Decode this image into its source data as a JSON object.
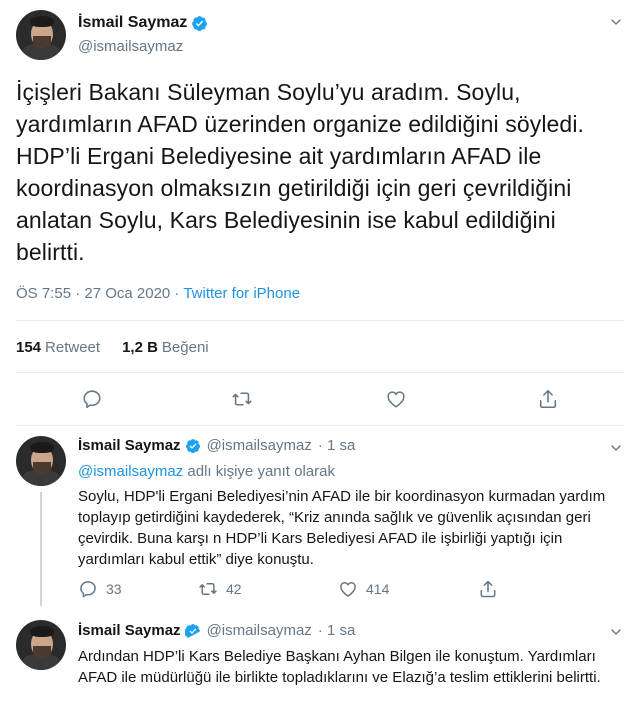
{
  "main_tweet": {
    "author_name": "İsmail Saymaz",
    "handle": "@ismailsaymaz",
    "text": "İçişleri Bakanı Süleyman Soylu’yu aradım. Soylu, yardımların AFAD üzerinden organize edildiğini söyledi. HDP’li Ergani Belediyesine ait yardımların AFAD ile koordinasyon olmaksızın getirildiği için geri çevrildiğini anlatan Soylu, Kars Belediyesinin ise kabul edildiğini belirtti.",
    "time": "ÖS 7:55 · 27 Oca 2020 · ",
    "source": "Twitter for iPhone",
    "retweets_count": "154",
    "retweets_label": "Retweet",
    "likes_count": "1,2 B",
    "likes_label": "Beğeni"
  },
  "replies": [
    {
      "author_name": "İsmail Saymaz",
      "handle": "@ismailsaymaz",
      "time": "· 1 sa",
      "reply_to_handle": "@ismailsaymaz",
      "reply_to_suffix": " adlı kişiye yanıt olarak",
      "text": "Soylu, HDP'li Ergani Belediyesi’nin AFAD ile bir koordinasyon kurmadan yardım toplayıp getirdiğini kaydederek, “Kriz anında sağlık ve güvenlik açısından geri çevirdik. Buna karşı n HDP’li Kars Belediyesi AFAD ile işbirliği yaptığı için yardımları kabul ettik” diye konuştu.",
      "replies_count": "33",
      "retweets_count": "42",
      "likes_count": "414"
    },
    {
      "author_name": "İsmail Saymaz",
      "handle": "@ismailsaymaz",
      "time": "· 1 sa",
      "text": "Ardından HDP’li Kars Belediye Başkanı Ayhan Bilgen ile konuştum. Yardımları AFAD ile müdürlüğü ile birlikte topladıklarını ve Elazığ’a teslim ettiklerini belirtti."
    }
  ],
  "colors": {
    "accent": "#1b95e0",
    "muted": "#657786",
    "divider": "#e6ecf0"
  },
  "icons": [
    "verified-badge-icon",
    "chevron-down-icon",
    "reply-icon",
    "retweet-icon",
    "like-icon",
    "share-icon"
  ]
}
